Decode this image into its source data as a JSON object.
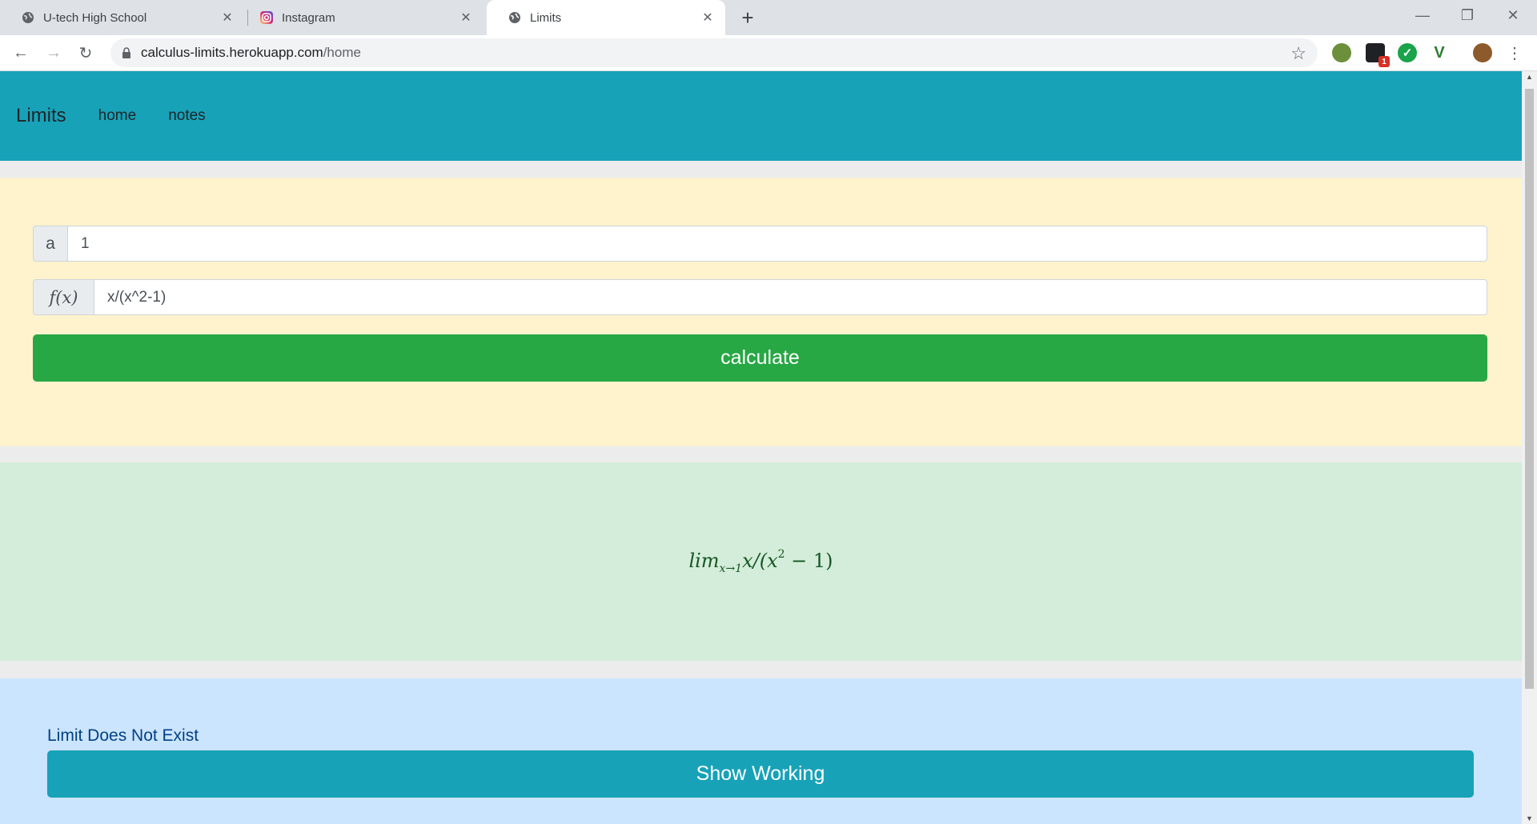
{
  "browser": {
    "tabs": [
      {
        "title": "U-tech High School",
        "icon": "globe-icon"
      },
      {
        "title": "Instagram",
        "icon": "instagram-icon"
      },
      {
        "title": "Limits",
        "icon": "globe-icon"
      }
    ],
    "active_tab": 2,
    "url_host": "calculus-limits.herokuapp.com",
    "url_path": "/home",
    "extension_badge": "1"
  },
  "navbar": {
    "brand": "Limits",
    "links": [
      "home",
      "notes"
    ]
  },
  "form": {
    "a_label": "a",
    "a_value": "1",
    "fx_label": "f(x)",
    "fx_value": "x/(x^2-1)",
    "calculate_label": "calculate"
  },
  "expression": {
    "lim": "lim",
    "subscript": "x→1",
    "body_before_power": "x/(x",
    "power": "2",
    "body_after_power": " − 1)"
  },
  "result": {
    "text": "Limit Does Not Exist",
    "show_working_label": "Show Working"
  },
  "colors": {
    "navbar": "#17a2b8",
    "form_panel": "#fff3cd",
    "math_panel": "#d4edda",
    "result_panel": "#cce5ff",
    "calculate_button": "#28a745",
    "show_working_button": "#17a2b8"
  }
}
